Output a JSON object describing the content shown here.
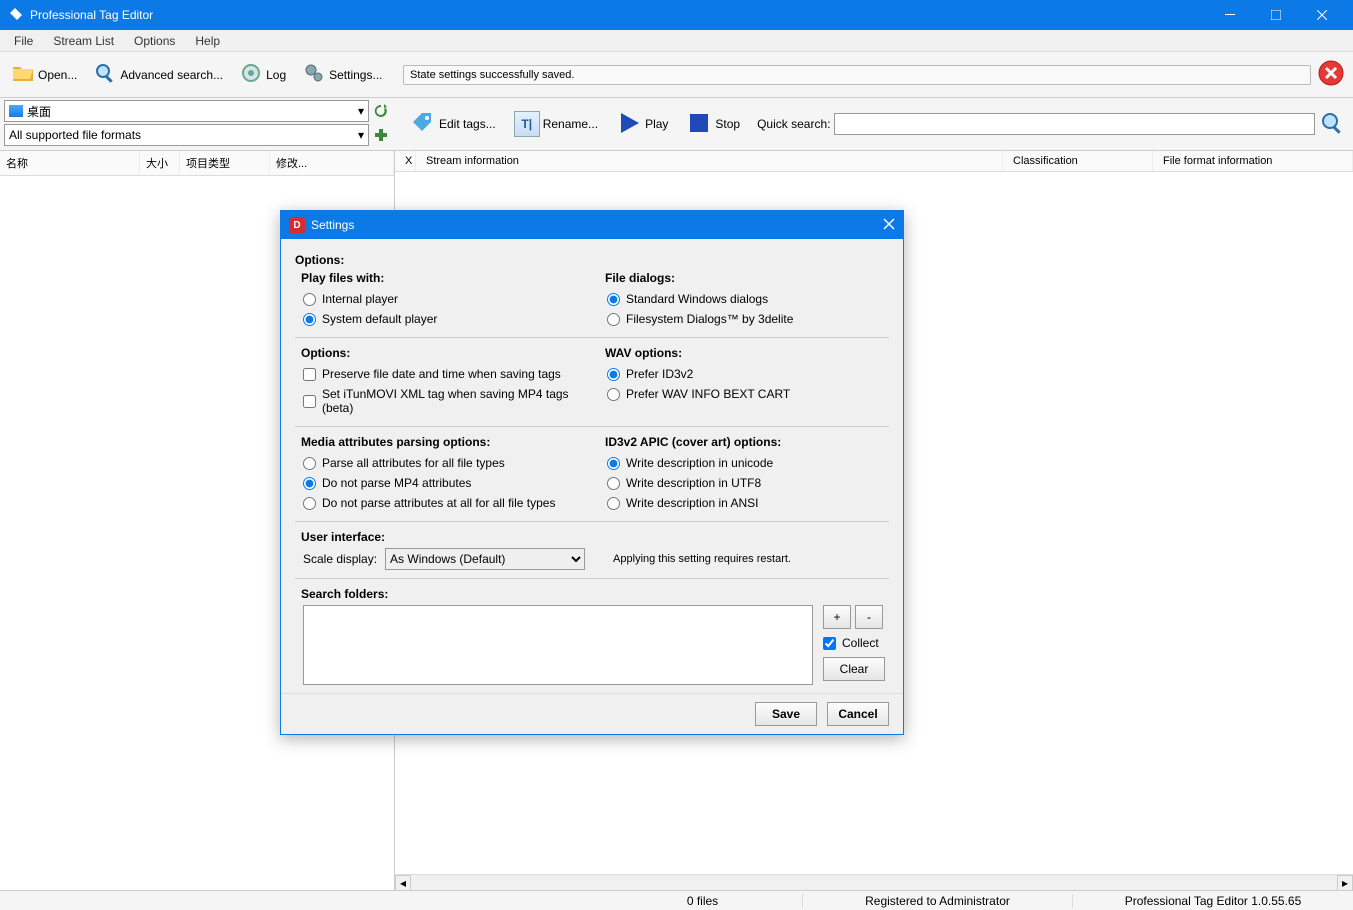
{
  "titlebar": {
    "title": "Professional Tag Editor"
  },
  "menubar": [
    "File",
    "Stream List",
    "Options",
    "Help"
  ],
  "toolbar": {
    "open": "Open...",
    "advsearch": "Advanced search...",
    "log": "Log",
    "settings": "Settings..."
  },
  "status": {
    "message": "State settings successfully saved."
  },
  "nav": {
    "location": "桌面",
    "filter": "All supported file formats"
  },
  "left_cols": {
    "name": "名称",
    "size": "大小",
    "type": "项目类型",
    "mod": "修改..."
  },
  "tools2": {
    "edit": "Edit tags...",
    "rename": "Rename...",
    "play": "Play",
    "stop": "Stop",
    "quick": "Quick search:"
  },
  "right_tabs": {
    "x": "X",
    "stream": "Stream information",
    "class": "Classification",
    "file": "File format information"
  },
  "statusbar": {
    "files": "0 files",
    "reg": "Registered to Administrator",
    "ver": "Professional Tag Editor 1.0.55.65"
  },
  "dialog": {
    "title": "Settings",
    "options_label": "Options:",
    "play_label": "Play files with:",
    "play_internal": "Internal player",
    "play_default": "System default player",
    "filedlg_label": "File dialogs:",
    "filedlg_std": "Standard Windows dialogs",
    "filedlg_3d": "Filesystem Dialogs™ by 3delite",
    "opt2_label": "Options:",
    "opt2_preserve": "Preserve file date and time when saving tags",
    "opt2_itun": "Set iTunMOVI XML tag when saving MP4 tags (beta)",
    "wav_label": "WAV options:",
    "wav_id3": "Prefer ID3v2",
    "wav_info": "Prefer WAV INFO BEXT CART",
    "media_label": "Media attributes parsing options:",
    "media_all": "Parse all attributes for all file types",
    "media_no_mp4": "Do not parse MP4 attributes",
    "media_none": "Do not parse attributes at all for all file types",
    "apic_label": "ID3v2 APIC (cover art) options:",
    "apic_uni": "Write description in unicode",
    "apic_utf8": "Write description in UTF8",
    "apic_ansi": "Write description in ANSI",
    "ui_label": "User interface:",
    "scale_label": "Scale display:",
    "scale_value": "As Windows (Default)",
    "scale_note": "Applying this setting requires restart.",
    "sf_label": "Search folders:",
    "sf_add": "+",
    "sf_remove": "-",
    "sf_collect": "Collect",
    "sf_clear": "Clear",
    "save": "Save",
    "cancel": "Cancel"
  }
}
